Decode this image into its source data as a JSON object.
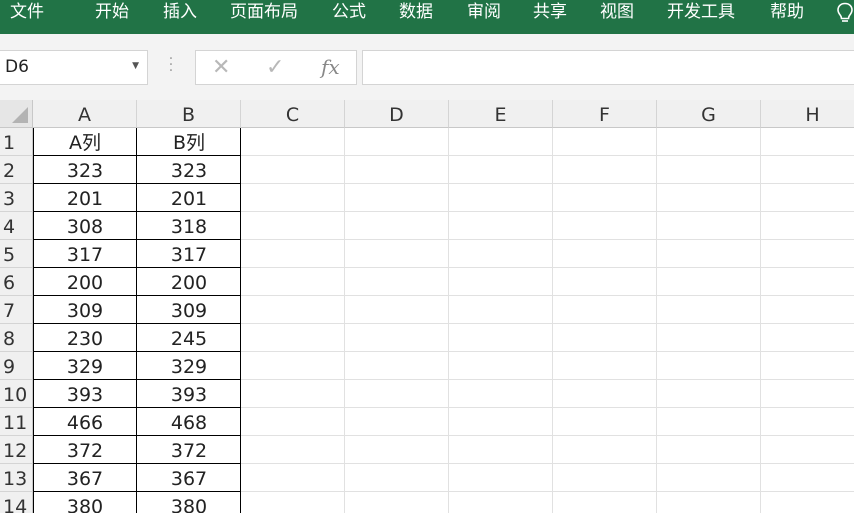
{
  "ribbon": {
    "tabs": [
      "文件",
      "开始",
      "插入",
      "页面布局",
      "公式",
      "数据",
      "审阅",
      "共享",
      "视图",
      "开发工具",
      "帮助"
    ],
    "bulb_icon": "lightbulb-icon",
    "color": "#217346"
  },
  "formula_bar": {
    "name_box": "D6",
    "cancel_symbol": "✕",
    "enter_symbol": "✓",
    "fx_symbol": "fx",
    "formula": ""
  },
  "sheet": {
    "columns": [
      "A",
      "B",
      "C",
      "D",
      "E",
      "F",
      "G",
      "H"
    ],
    "rows": [
      {
        "num": "1",
        "a": "A列",
        "b": "B列"
      },
      {
        "num": "2",
        "a": "323",
        "b": "323"
      },
      {
        "num": "3",
        "a": "201",
        "b": "201"
      },
      {
        "num": "4",
        "a": "308",
        "b": "318"
      },
      {
        "num": "5",
        "a": "317",
        "b": "317"
      },
      {
        "num": "6",
        "a": "200",
        "b": "200"
      },
      {
        "num": "7",
        "a": "309",
        "b": "309"
      },
      {
        "num": "8",
        "a": "230",
        "b": "245"
      },
      {
        "num": "9",
        "a": "329",
        "b": "329"
      },
      {
        "num": "10",
        "a": "393",
        "b": "393"
      },
      {
        "num": "11",
        "a": "466",
        "b": "468"
      },
      {
        "num": "12",
        "a": "372",
        "b": "372"
      },
      {
        "num": "13",
        "a": "367",
        "b": "367"
      },
      {
        "num": "14",
        "a": "380",
        "b": "380"
      }
    ]
  }
}
